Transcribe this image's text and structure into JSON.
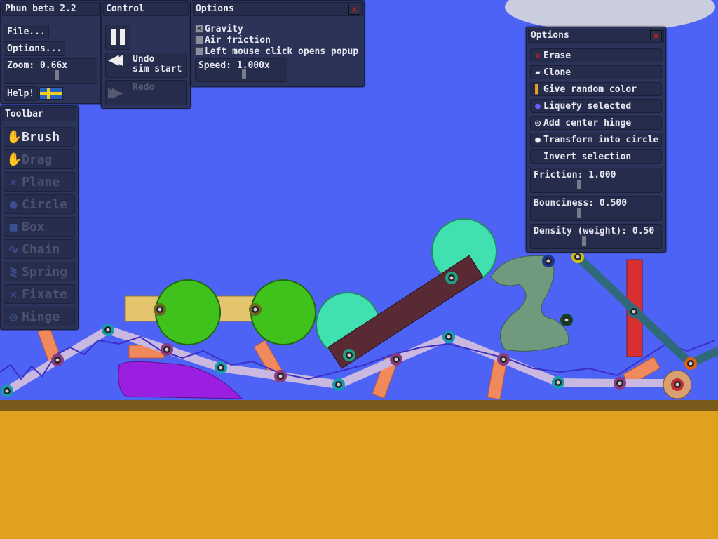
{
  "main_panel": {
    "title": "Phun beta 2.2",
    "file": "File...",
    "options": "Options...",
    "zoom": "Zoom: 0.66x",
    "zoom_level": 0.5,
    "help": "Help!",
    "language": "sweden-flag"
  },
  "control": {
    "title": "Control",
    "pause": "pause-icon",
    "undo_line1": "Undo",
    "undo_line2": "sim start",
    "redo": "Redo"
  },
  "options": {
    "title": "Options",
    "checkboxes": [
      {
        "label": "Gravity",
        "checked": true
      },
      {
        "label": "Air friction",
        "checked": false
      },
      {
        "label": "Left mouse click opens popup",
        "checked": false
      }
    ],
    "speed": "Speed: 1.000x",
    "speed_level": 0.5
  },
  "toolbar": {
    "title": "Toolbar",
    "tools": [
      {
        "label": "Brush",
        "icon": "hand-icon",
        "active": true
      },
      {
        "label": "Drag",
        "icon": "drag-hand-icon"
      },
      {
        "label": "Plane",
        "icon": "plane-icon"
      },
      {
        "label": "Circle",
        "icon": "circle-icon"
      },
      {
        "label": "Box",
        "icon": "box-icon"
      },
      {
        "label": "Chain",
        "icon": "chain-icon"
      },
      {
        "label": "Spring",
        "icon": "spring-icon"
      },
      {
        "label": "Fixate",
        "icon": "fixate-icon"
      },
      {
        "label": "Hinge",
        "icon": "hinge-icon"
      }
    ]
  },
  "popup": {
    "title": "Options",
    "items": [
      "Erase",
      "Clone",
      "Give random color",
      "Liquefy selected",
      "Add center hinge",
      "Transform into circle",
      "Invert selection"
    ],
    "friction": "Friction: 1.000",
    "friction_level": 0.5,
    "bounciness": "Bounciness: 0.500",
    "bounciness_level": 0.5,
    "density": "Density (weight): 0.50",
    "density_level": 0.5
  },
  "colors": {
    "sky": "#4d63f6",
    "ground": "#e0a21e",
    "ground_edge": "#7a5a1a",
    "panel": "#2c3358"
  }
}
